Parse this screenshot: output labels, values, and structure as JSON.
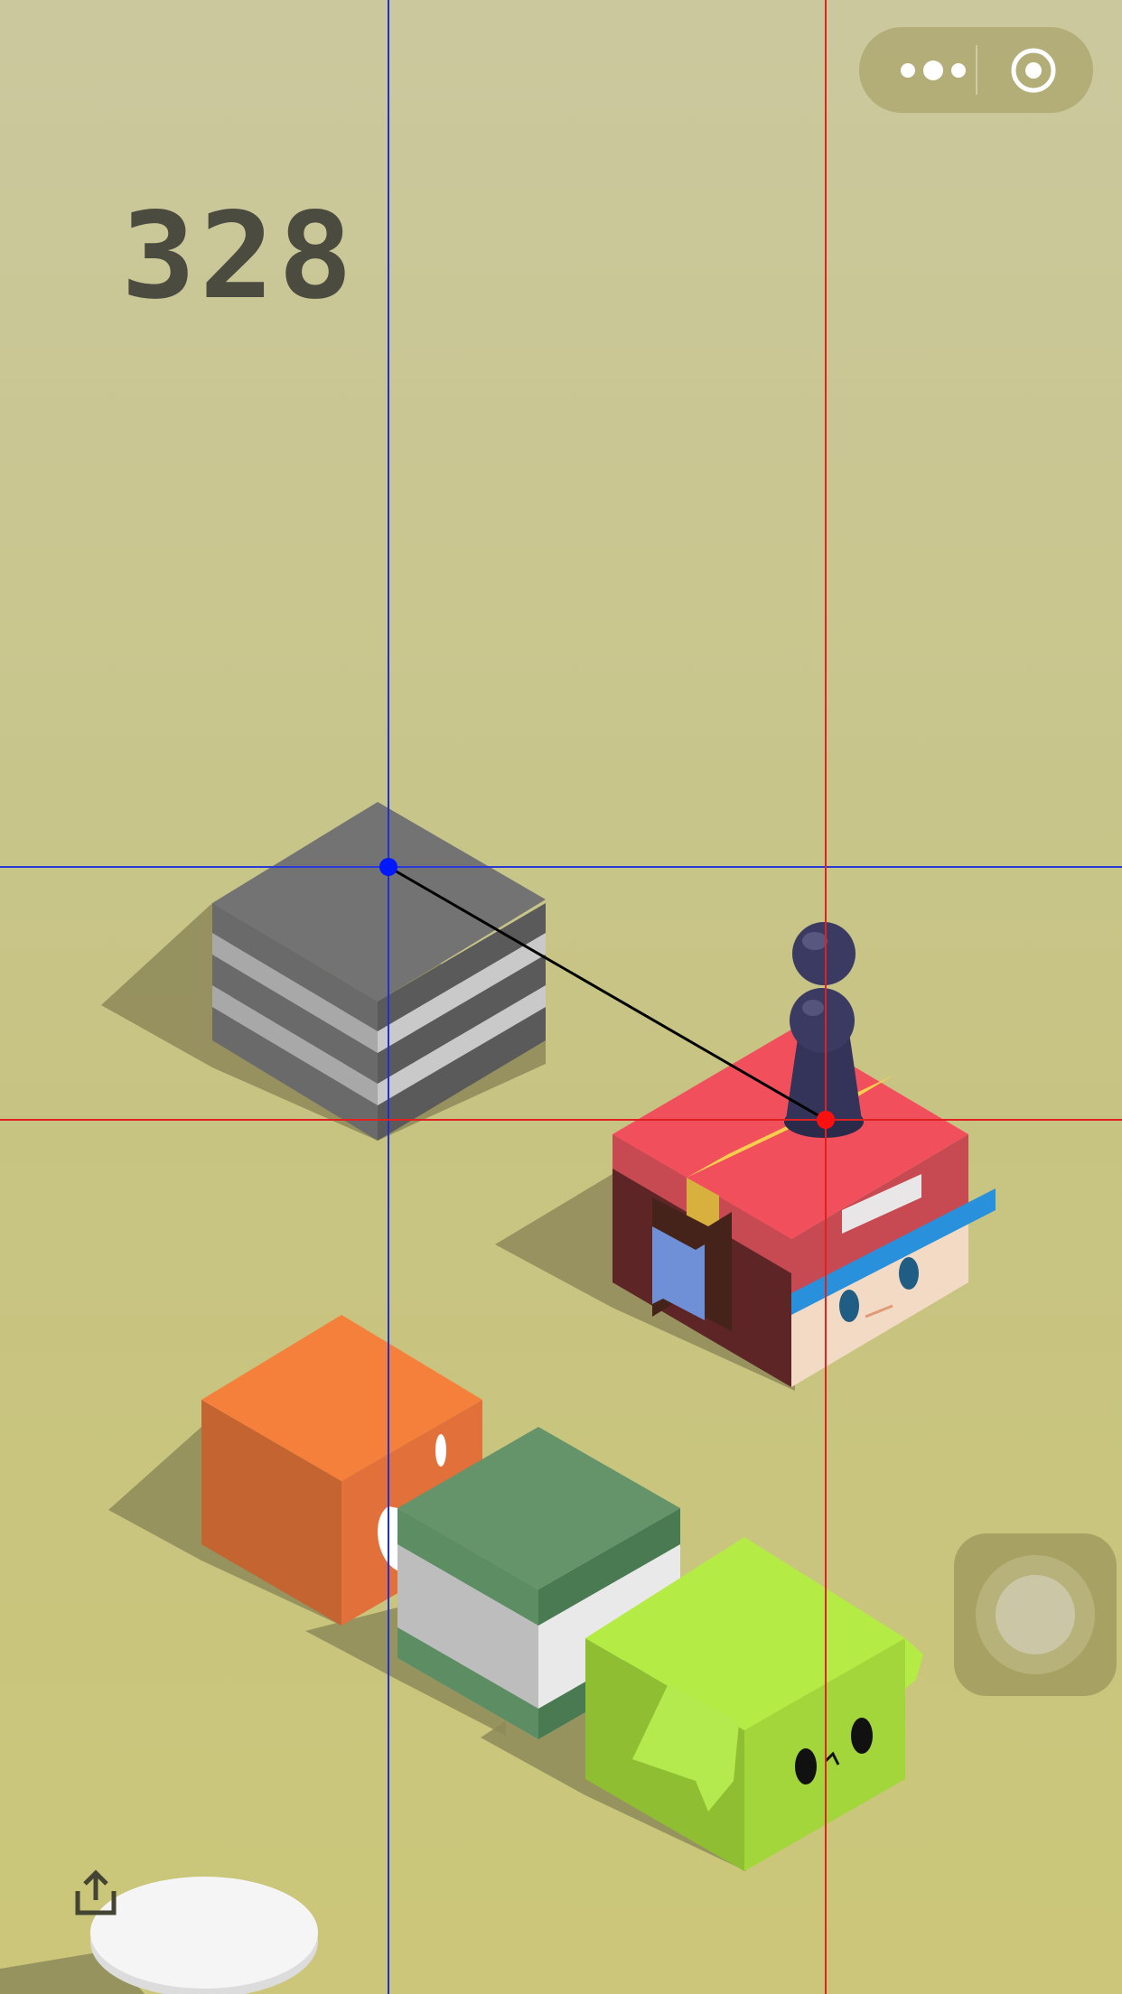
{
  "game": {
    "score": "328"
  },
  "hud": {
    "more_icon": "ellipsis-icon",
    "close_icon": "target-circle-icon",
    "share_icon": "share-upload-icon"
  },
  "colors": {
    "guide_vertical_blue": "#1f2fd6",
    "guide_horizontal_blue": "#2a3ad8",
    "guide_red": "#e0211f",
    "marker_blue": "#0018ff",
    "marker_red": "#ff1010",
    "player": "#34345a"
  }
}
